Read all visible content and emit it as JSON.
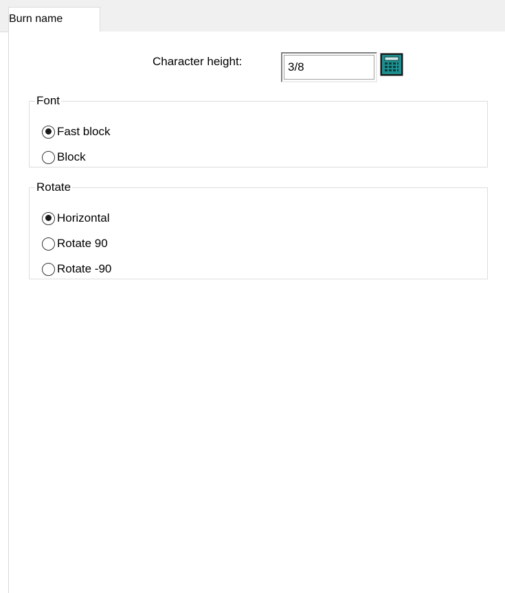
{
  "tab": {
    "label": "Burn name"
  },
  "character_height": {
    "label": "Character height:",
    "value": "3/8",
    "calculator_icon": "calculator-icon"
  },
  "font_group": {
    "title": "Font",
    "options": [
      {
        "label": "Fast block",
        "checked": true
      },
      {
        "label": "Block",
        "checked": false
      }
    ]
  },
  "rotate_group": {
    "title": "Rotate",
    "options": [
      {
        "label": "Horizontal",
        "checked": true
      },
      {
        "label": "Rotate 90",
        "checked": false
      },
      {
        "label": "Rotate -90",
        "checked": false
      }
    ]
  },
  "colors": {
    "tab_strip_bg": "#f0f0f0",
    "calculator_teal": "#1f8f8f"
  }
}
